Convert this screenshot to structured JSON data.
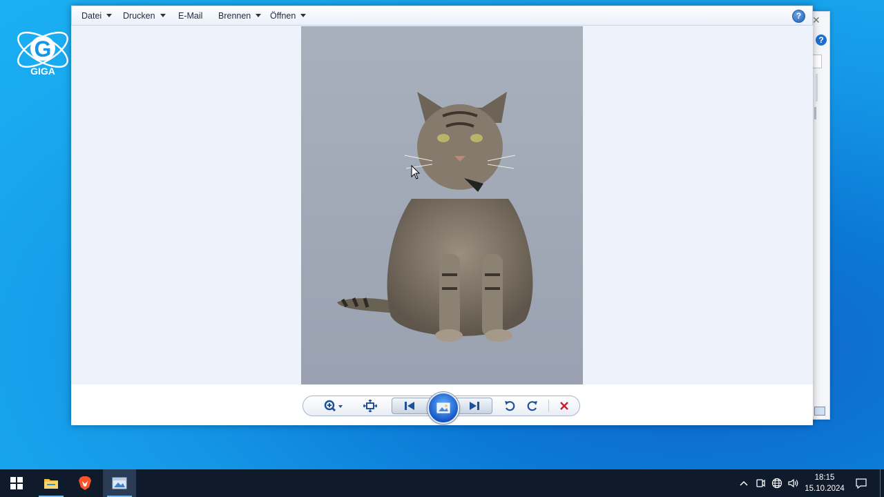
{
  "watermark": {
    "letter": "G",
    "text": "GIGA"
  },
  "viewer": {
    "menu": [
      {
        "label": "Datei",
        "has_dropdown": true
      },
      {
        "label": "Drucken",
        "has_dropdown": true
      },
      {
        "label": "E-Mail",
        "has_dropdown": false
      },
      {
        "label": "Brennen",
        "has_dropdown": true
      },
      {
        "label": "Öffnen",
        "has_dropdown": true
      }
    ],
    "help_label": "?",
    "controls": [
      {
        "name": "zoom-button",
        "icon": "magnifier-icon"
      },
      {
        "name": "fit-window-button",
        "icon": "fit-to-window-icon"
      },
      {
        "name": "previous-button",
        "icon": "skip-previous-icon"
      },
      {
        "name": "slideshow-button",
        "icon": "slideshow-icon"
      },
      {
        "name": "next-button",
        "icon": "skip-next-icon"
      },
      {
        "name": "rotate-left-button",
        "icon": "rotate-counterclockwise-icon"
      },
      {
        "name": "rotate-right-button",
        "icon": "rotate-clockwise-icon"
      },
      {
        "name": "delete-button",
        "icon": "delete-x-icon"
      }
    ],
    "delete_color": "#c8202f"
  },
  "background_window": {
    "help_label": "?"
  },
  "taskbar": {
    "items": [
      "start-icon",
      "file-explorer-icon",
      "brave-browser-icon",
      "photo-viewer-icon"
    ],
    "tray": [
      "chevron-up-icon",
      "meet-now-icon",
      "network-globe-icon",
      "speaker-icon"
    ],
    "time": "18:15",
    "date": "15.10.2024"
  }
}
